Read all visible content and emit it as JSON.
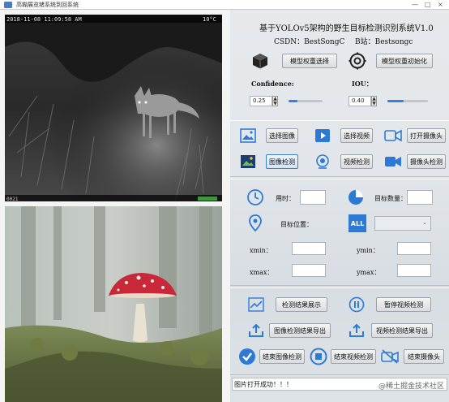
{
  "window": {
    "title": "高糊展览猪系统到回系统",
    "controls": [
      "—",
      "□",
      "×"
    ]
  },
  "camera_overlay": {
    "timestamp": "2018-11-08 11:09:58 AM",
    "weather": "10°C",
    "footer_left": "0021"
  },
  "header": {
    "title": "基于YOLOv5架构的野生目标检测识别系统V1.0",
    "csdn": "CSDN：BestSongC",
    "bilibili": "B站：Bestsongc"
  },
  "model": {
    "select_label": "模型权重选择",
    "init_label": "模型权重初始化"
  },
  "params": {
    "confidence_label": "Confidence:",
    "iou_label": "IOU：",
    "confidence_value": "0.25",
    "iou_value": "0.40",
    "confidence_level": 0.25,
    "iou_level": 0.4
  },
  "actions": {
    "select_image": "选择图像",
    "select_video": "选择视频",
    "open_camera": "打开摄像头",
    "detect_image": "图像检测",
    "detect_video": "视频检测",
    "detect_camera": "摄像头检测"
  },
  "results": {
    "time_label": "用时：",
    "count_label": "目标数量：",
    "position_label": "目标位置：",
    "xmin": "xmin：",
    "ymin": "ymin：",
    "xmax": "xmax：",
    "ymax": "ymax：",
    "all_badge": "ALL"
  },
  "bottom": {
    "show_results": "检测结果展示",
    "pause_video": "暂停视频检测",
    "export_image": "图像检测结果导出",
    "export_video": "视频检测结果导出",
    "end_image": "结束图像检测",
    "end_video": "结束视频检测",
    "end_camera": "结束摄像头"
  },
  "status": {
    "message": "图片打开成功！！！"
  },
  "watermark": "@稀土掘金技术社区",
  "colors": {
    "accent": "#3a7fd0",
    "icon_blue": "#2d7ad6"
  }
}
